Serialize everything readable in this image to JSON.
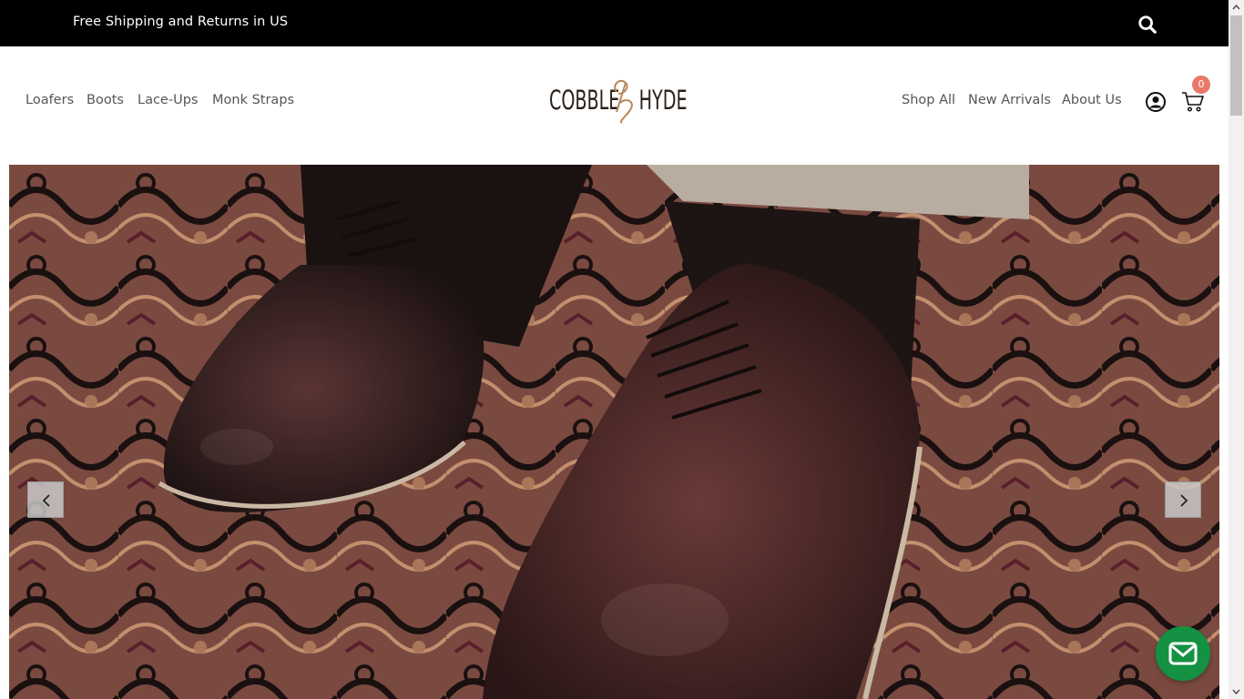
{
  "announcement": {
    "text": "Free Shipping and Returns in US"
  },
  "icons": {
    "search": "search-icon",
    "account": "user-circle-icon",
    "cart": "shopping-cart-icon",
    "prev": "chevron-left-icon",
    "next": "chevron-right-icon",
    "chat": "envelope-icon"
  },
  "nav_left": [
    {
      "label": "Loafers"
    },
    {
      "label": "Boots"
    },
    {
      "label": "Lace-Ups"
    },
    {
      "label": "Monk Straps"
    }
  ],
  "logo": {
    "left_word": "COBBLE",
    "right_word": "HYDE",
    "mark": "96"
  },
  "nav_right": [
    {
      "label": "Shop All"
    },
    {
      "label": "New Arrivals"
    },
    {
      "label": "About Us"
    }
  ],
  "cart": {
    "count": "0"
  },
  "colors": {
    "top_bar": "#000000",
    "badge": "#e8786a",
    "chat_button": "#149142",
    "logo_dark": "#2b2018",
    "logo_accent": "#b8875a"
  }
}
